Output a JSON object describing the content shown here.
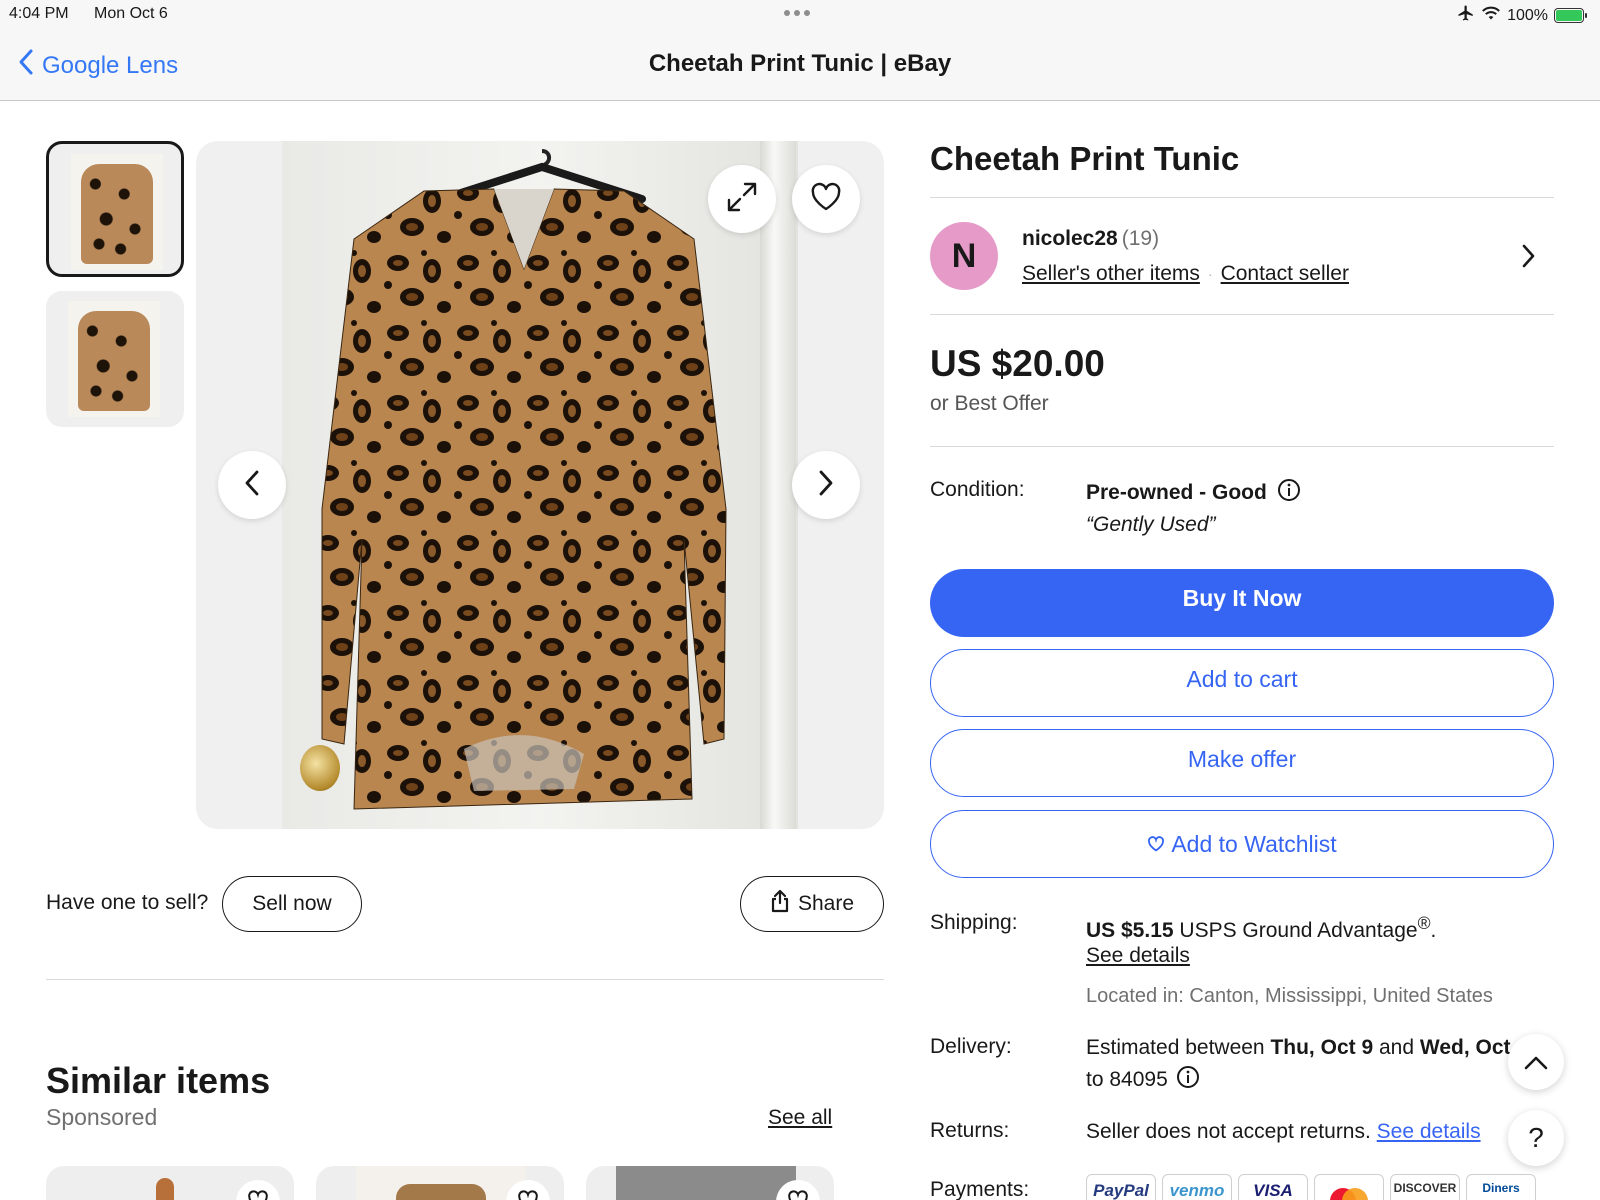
{
  "status_bar": {
    "time": "4:04 PM",
    "date": "Mon Oct 6",
    "battery": "100%"
  },
  "nav": {
    "back_label": "Google Lens",
    "title": "Cheetah Print Tunic | eBay"
  },
  "listing": {
    "title": "Cheetah Print Tunic",
    "seller": {
      "initial": "N",
      "name": "nicolec28",
      "feedback": "(19)",
      "other_items_label": "Seller's other items",
      "separator": "·",
      "contact_label": "Contact seller"
    },
    "price": "US $20.00",
    "price_note": "or Best Offer",
    "condition": {
      "label": "Condition:",
      "value": "Pre-owned - Good",
      "note": "“Gently Used”"
    },
    "buttons": {
      "buy_now": "Buy It Now",
      "add_to_cart": "Add to cart",
      "make_offer": "Make offer",
      "watchlist": "Add to Watchlist"
    },
    "shipping": {
      "label": "Shipping:",
      "cost": "US $5.15",
      "service": "USPS Ground Advantage",
      "service_mark": "®",
      "period": ".",
      "details_label": "See details",
      "location": "Located in: Canton, Mississippi, United States"
    },
    "delivery": {
      "label": "Delivery:",
      "prefix": "Estimated between",
      "date_from": "Thu, Oct 9",
      "and": "and",
      "date_to": "Wed, Oct",
      "zip_line": "to 84095"
    },
    "returns": {
      "label": "Returns:",
      "text": "Seller does not accept returns.",
      "details_label": "See details"
    },
    "payments": {
      "label": "Payments:",
      "methods": [
        "PayPal",
        "venmo",
        "VISA",
        "Mastercard",
        "DISCOVER",
        "Diners"
      ]
    }
  },
  "gallery": {
    "sell_prompt": "Have one to sell?",
    "sell_now_label": "Sell now",
    "share_label": "Share"
  },
  "similar": {
    "title": "Similar items",
    "subtitle": "Sponsored",
    "see_all_label": "See all"
  },
  "float": {
    "help_label": "?"
  },
  "colors": {
    "accent": "#3665f3",
    "avatar": "#e59ac8",
    "ios_link": "#3478f6"
  }
}
